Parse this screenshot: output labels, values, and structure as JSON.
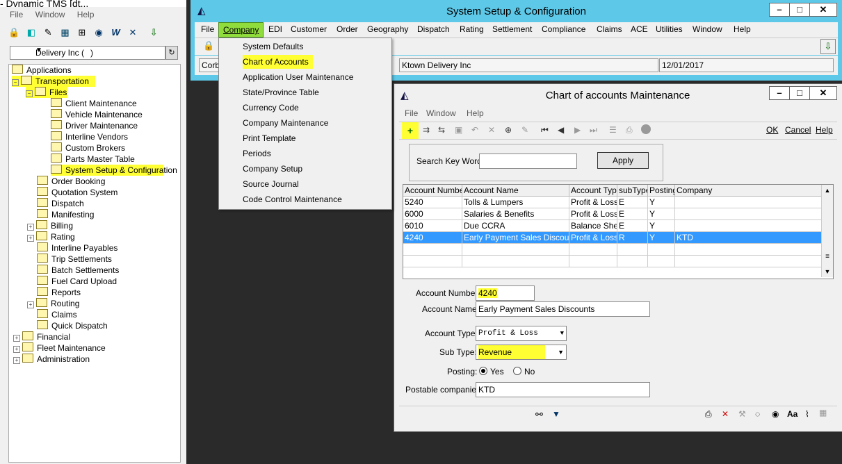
{
  "left_app": {
    "title": "- Dynamic TMS [dt...",
    "menu": [
      "File",
      "Window",
      "Help"
    ],
    "company_value": "Delivery Inc (",
    "company_suffix": ")",
    "tree": [
      {
        "label": "Applications",
        "level": 0
      },
      {
        "label": "Transportation",
        "level": 1
      },
      {
        "label": "Files",
        "level": 2
      },
      {
        "label": "Client Maintenance",
        "level": 3
      },
      {
        "label": "Vehicle Maintenance",
        "level": 3
      },
      {
        "label": "Driver Maintenance",
        "level": 3
      },
      {
        "label": "Interline Vendors",
        "level": 3
      },
      {
        "label": "Custom Brokers",
        "level": 3
      },
      {
        "label": "Parts Master Table",
        "level": 3
      },
      {
        "label": "System Setup & Configuration",
        "level": 3
      },
      {
        "label": "Order Booking",
        "level": 2
      },
      {
        "label": "Quotation System",
        "level": 2
      },
      {
        "label": "Dispatch",
        "level": 2
      },
      {
        "label": "Manifesting",
        "level": 2
      },
      {
        "label": "Billing",
        "level": 2
      },
      {
        "label": "Rating",
        "level": 2
      },
      {
        "label": "Interline Payables",
        "level": 2
      },
      {
        "label": "Trip Settlements",
        "level": 2
      },
      {
        "label": "Batch Settlements",
        "level": 2
      },
      {
        "label": "Fuel Card Upload",
        "level": 2
      },
      {
        "label": "Reports",
        "level": 2
      },
      {
        "label": "Routing",
        "level": 2
      },
      {
        "label": "Claims",
        "level": 2
      },
      {
        "label": "Quick Dispatch",
        "level": 2
      },
      {
        "label": "Financial",
        "level": 1
      },
      {
        "label": "Fleet Maintenance",
        "level": 1
      },
      {
        "label": "Administration",
        "level": 1
      }
    ]
  },
  "system_setup": {
    "title": "System Setup & Configuration",
    "menu": [
      "File",
      "Company",
      "EDI",
      "Customer",
      "Order",
      "Geography",
      "Dispatch",
      "Rating",
      "Settlement",
      "Compliance",
      "Claims",
      "ACE",
      "Utilities",
      "Window",
      "Help"
    ],
    "field_left": "Corba",
    "company_name": "Ktown Delivery Inc",
    "date": "12/01/2017"
  },
  "company_menu": [
    "System Defaults",
    "Chart of Accounts",
    "Application User Maintenance",
    "State/Province Table",
    "Currency Code",
    "Company Maintenance",
    "Print Template",
    "Periods",
    "Company Setup",
    "Source Journal",
    "Code Control Maintenance"
  ],
  "chart_window": {
    "title": "Chart of accounts Maintenance",
    "menu": [
      "File",
      "Window",
      "Help"
    ],
    "toolbar_right": [
      "OK",
      "Cancel",
      "Help"
    ],
    "search_label": "Search Key Word:",
    "search_value": "",
    "apply_label": "Apply",
    "columns": [
      "Account Number",
      "Account Name",
      "Account Type",
      "subType",
      "Posting",
      "Company"
    ],
    "rows": [
      [
        "5240",
        "Tolls & Lumpers",
        "Profit & Loss",
        "E",
        "Y",
        ""
      ],
      [
        "6000",
        "Salaries & Benefits",
        "Profit & Loss",
        "E",
        "Y",
        ""
      ],
      [
        "6010",
        "Due CCRA",
        "Balance Shee",
        "E",
        "Y",
        ""
      ],
      [
        "4240",
        "Early Payment Sales Discounts",
        "Profit & Loss",
        "R",
        "Y",
        "KTD"
      ]
    ],
    "form": {
      "account_number_label": "Account Number:",
      "account_number": "4240",
      "account_name_label": "Account Name:",
      "account_name": "Early Payment Sales Discounts",
      "account_type_label": "Account Type:",
      "account_type": "Profit & Loss",
      "sub_type_label": "Sub Type:",
      "sub_type": "Revenue",
      "posting_label": "Posting:",
      "posting_yes": "Yes",
      "posting_no": "No",
      "postable_label": "Postable companies:",
      "postable": "KTD"
    }
  },
  "colors": {
    "highlight": "#ffff33",
    "selection": "#3399ff",
    "title_bar": "#5dc8e8"
  }
}
